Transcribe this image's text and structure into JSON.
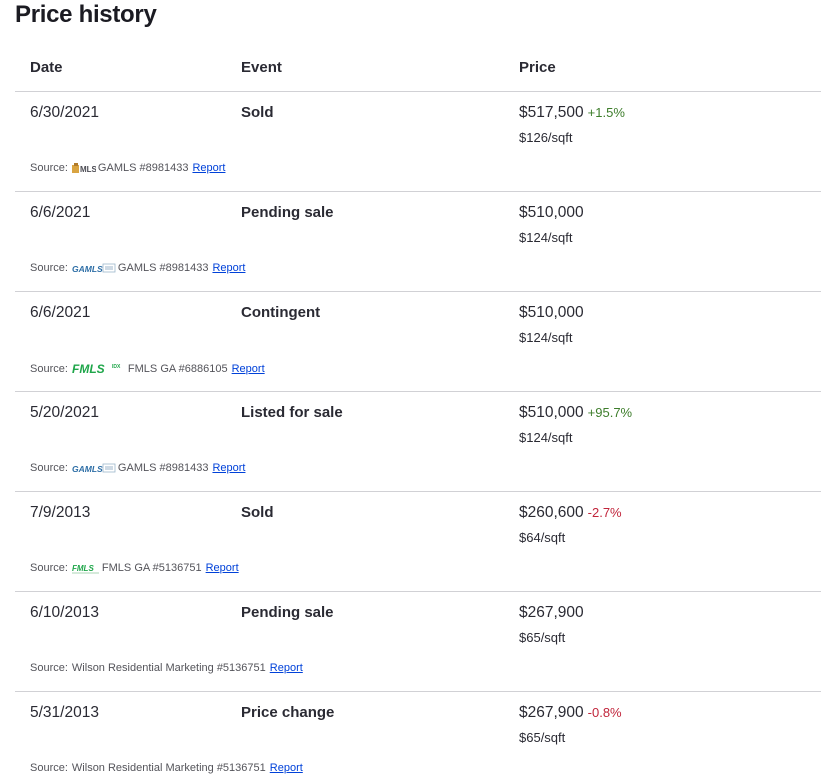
{
  "title": "Price history",
  "columns": {
    "date": "Date",
    "event": "Event",
    "price": "Price"
  },
  "source_prefix": "Source:",
  "report_label": "Report",
  "colors": {
    "up": "#3d7d2b",
    "down": "#c1253b",
    "link": "#0041d9",
    "fmls_green": "#1fa64a",
    "gamls_blue": "#2d6ea6"
  },
  "rows": [
    {
      "date": "6/30/2021",
      "event": "Sold",
      "price": "$517,500",
      "change": "+1.5%",
      "change_dir": "up",
      "sqft": "$126/sqft",
      "source_logo": "gamls-old-logo",
      "source_text": "GAMLS #8981433"
    },
    {
      "date": "6/6/2021",
      "event": "Pending sale",
      "price": "$510,000",
      "change": "",
      "change_dir": "",
      "sqft": "$124/sqft",
      "source_logo": "gamls-logo",
      "source_text": "GAMLS #8981433"
    },
    {
      "date": "6/6/2021",
      "event": "Contingent",
      "price": "$510,000",
      "change": "",
      "change_dir": "",
      "sqft": "$124/sqft",
      "source_logo": "fmls-idx-logo",
      "source_text": "FMLS GA #6886105"
    },
    {
      "date": "5/20/2021",
      "event": "Listed for sale",
      "price": "$510,000",
      "change": "+95.7%",
      "change_dir": "up",
      "sqft": "$124/sqft",
      "source_logo": "gamls-logo",
      "source_text": "GAMLS #8981433"
    },
    {
      "date": "7/9/2013",
      "event": "Sold",
      "price": "$260,600",
      "change": "-2.7%",
      "change_dir": "down",
      "sqft": "$64/sqft",
      "source_logo": "fmls-small-logo",
      "source_text": "FMLS GA #5136751"
    },
    {
      "date": "6/10/2013",
      "event": "Pending sale",
      "price": "$267,900",
      "change": "",
      "change_dir": "",
      "sqft": "$65/sqft",
      "source_logo": "",
      "source_text": "Wilson Residential Marketing #5136751"
    },
    {
      "date": "5/31/2013",
      "event": "Price change",
      "price": "$267,900",
      "change": "-0.8%",
      "change_dir": "down",
      "sqft": "$65/sqft",
      "source_logo": "",
      "source_text": "Wilson Residential Marketing #5136751"
    }
  ]
}
